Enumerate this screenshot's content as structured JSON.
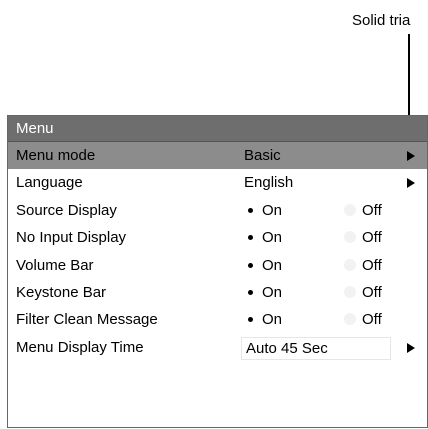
{
  "callout": {
    "text": "Solid tria"
  },
  "menu": {
    "title": "Menu",
    "rows": [
      {
        "label": "Menu mode",
        "value": "Basic"
      },
      {
        "label": "Language",
        "value": "English"
      },
      {
        "label": "Source Display",
        "on": "On",
        "off": "Off",
        "selected": "On"
      },
      {
        "label": "No Input Display",
        "on": "On",
        "off": "Off",
        "selected": "On"
      },
      {
        "label": "Volume Bar",
        "on": "On",
        "off": "Off",
        "selected": "On"
      },
      {
        "label": "Keystone Bar",
        "on": "On",
        "off": "Off",
        "selected": "On"
      },
      {
        "label": "Filter Clean Message",
        "on": "On",
        "off": "Off",
        "selected": "On"
      },
      {
        "label": "Menu Display Time",
        "value": "Auto 45 Sec"
      }
    ]
  }
}
